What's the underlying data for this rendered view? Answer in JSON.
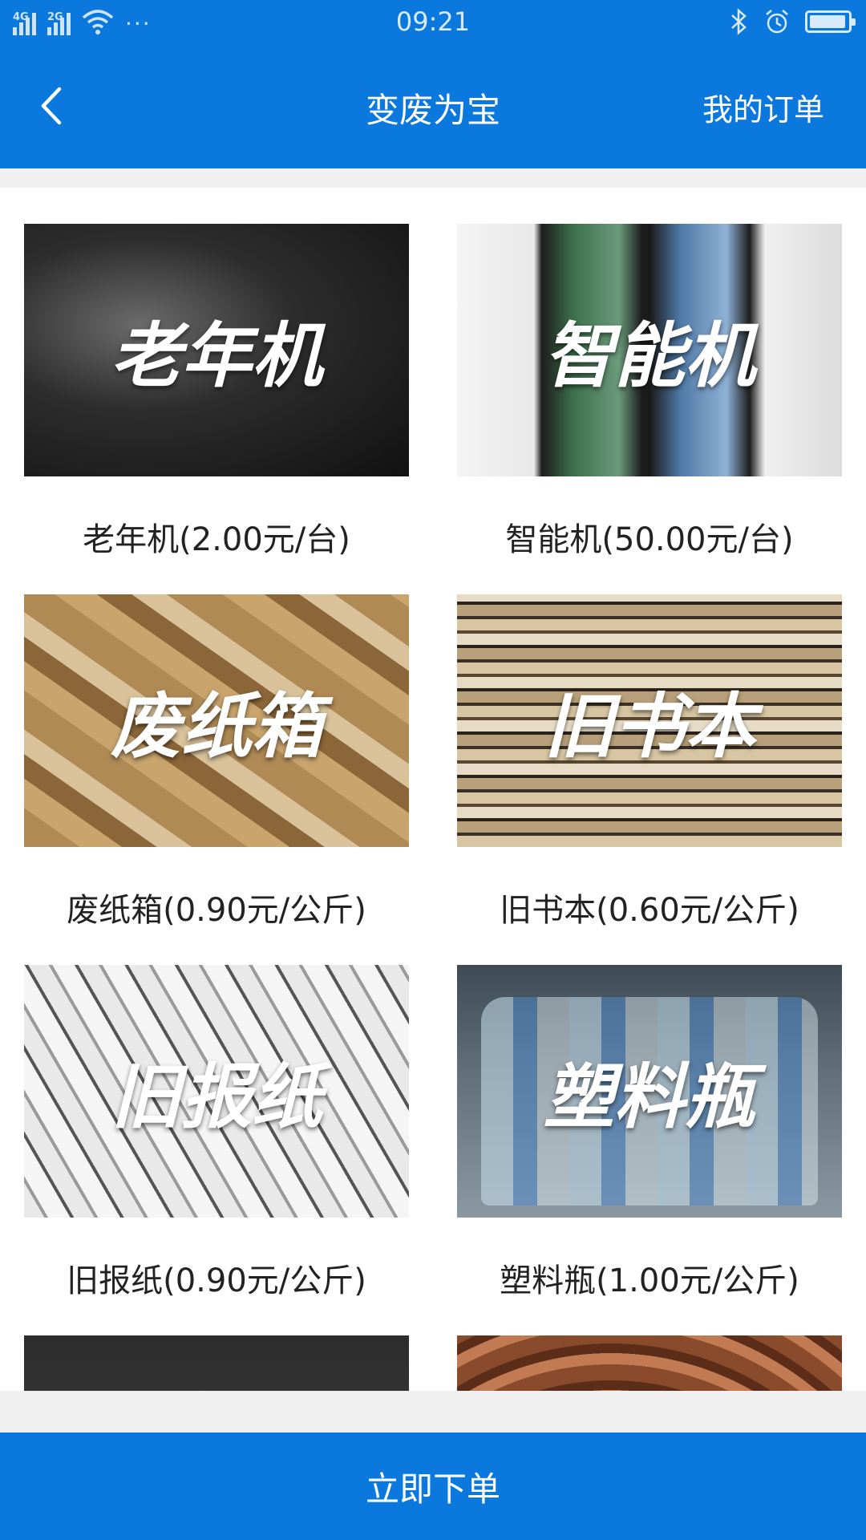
{
  "status_bar": {
    "signal1_label": "4G",
    "signal2_label": "2G",
    "more": "···",
    "time": "09:21"
  },
  "header": {
    "title": "变废为宝",
    "orders_link": "我的订单"
  },
  "items": [
    {
      "overlay": "老年机",
      "caption": "老年机(2.00元/台)"
    },
    {
      "overlay": "智能机",
      "caption": "智能机(50.00元/台)"
    },
    {
      "overlay": "废纸箱",
      "caption": "废纸箱(0.90元/公斤)"
    },
    {
      "overlay": "旧书本",
      "caption": "旧书本(0.60元/公斤)"
    },
    {
      "overlay": "旧报纸",
      "caption": "旧报纸(0.90元/公斤)"
    },
    {
      "overlay": "塑料瓶",
      "caption": "塑料瓶(1.00元/公斤)"
    }
  ],
  "footer": {
    "order_button": "立即下单"
  },
  "colors": {
    "primary": "#0a78dc",
    "background_gap": "#f0f0f0"
  }
}
